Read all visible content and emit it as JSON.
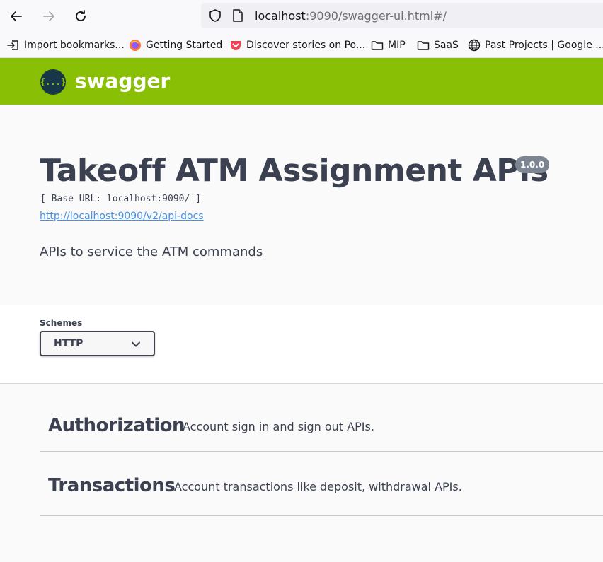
{
  "browser": {
    "url_host": "localhost",
    "url_rest": ":9090/swagger-ui.html#/",
    "bookmarks": [
      {
        "label": "Import bookmarks...",
        "icon": "import-icon"
      },
      {
        "label": "Getting Started",
        "icon": "firefox-icon"
      },
      {
        "label": "Discover stories on Po...",
        "icon": "pocket-icon"
      },
      {
        "label": "MIP",
        "icon": "folder-icon"
      },
      {
        "label": "SaaS",
        "icon": "folder-icon"
      },
      {
        "label": "Past Projects | Google ...",
        "icon": "globe-icon"
      }
    ]
  },
  "topbar": {
    "logo_symbol": "{...}",
    "logo_text": "swagger",
    "color": "#89bf04"
  },
  "info": {
    "title": "Takeoff ATM Assignment APIs",
    "version": "1.0.0",
    "base_url": "[ Base URL: localhost:9090/ ]",
    "spec_link": "http://localhost:9090/v2/api-docs",
    "description": "APIs to service the ATM commands"
  },
  "schemes": {
    "label": "Schemes",
    "selected": "HTTP"
  },
  "tags": [
    {
      "name": "Authorization",
      "description": "Account sign in and sign out APIs."
    },
    {
      "name": "Transactions",
      "description": "Account transactions like deposit, withdrawal APIs."
    }
  ]
}
